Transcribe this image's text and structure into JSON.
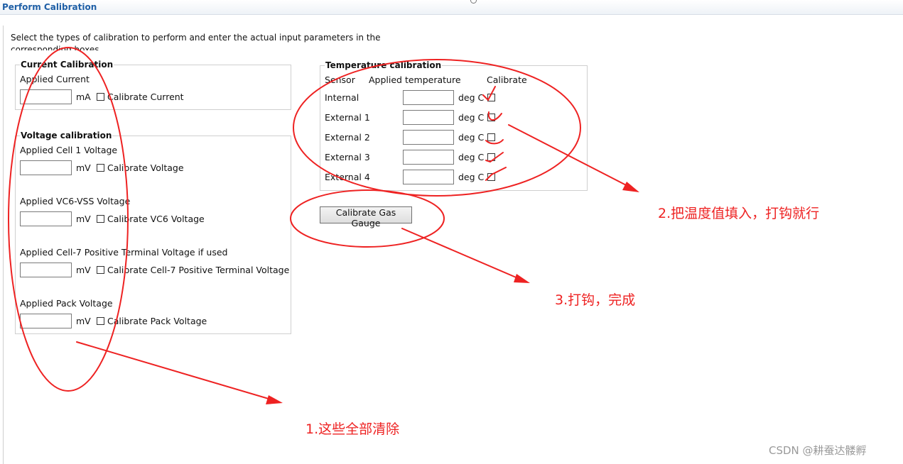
{
  "window": {
    "title": "Perform Calibration"
  },
  "intro": "Select the types of calibration to perform and enter the actual input parameters in the corresponding boxes",
  "current": {
    "legend": "Current Calibration",
    "label": "Applied Current",
    "value": "",
    "unit": "mA",
    "checkbox_label": "Calibrate Current"
  },
  "voltage": {
    "legend": "Voltage calibration",
    "rows": [
      {
        "label": "Applied Cell 1 Voltage",
        "value": "",
        "unit": "mV",
        "checkbox_label": "Calibrate Voltage"
      },
      {
        "label": "Applied VC6-VSS Voltage",
        "value": "",
        "unit": "mV",
        "checkbox_label": "Calibrate VC6 Voltage"
      },
      {
        "label": "Applied Cell-7 Positive Terminal Voltage if used",
        "value": "",
        "unit": "mV",
        "checkbox_label": "Calibrate Cell-7 Positive Terminal Voltage"
      },
      {
        "label": "Applied Pack Voltage",
        "value": "",
        "unit": "mV",
        "checkbox_label": "Calibrate Pack Voltage"
      }
    ]
  },
  "temperature": {
    "legend": "Temperature calibration",
    "headers": {
      "sensor": "Sensor",
      "applied": "Applied temperature",
      "calibrate": "Calibrate"
    },
    "rows": [
      {
        "sensor": "Internal",
        "value": "",
        "unit": "deg C"
      },
      {
        "sensor": "External 1",
        "value": "",
        "unit": "deg C"
      },
      {
        "sensor": "External 2",
        "value": "",
        "unit": "deg C"
      },
      {
        "sensor": "External 3",
        "value": "",
        "unit": "deg C"
      },
      {
        "sensor": "External 4",
        "value": "",
        "unit": "deg C"
      }
    ]
  },
  "action": {
    "button_label": "Calibrate Gas Gauge"
  },
  "annotations": {
    "note1": "1.这些全部清除",
    "note2": "2.把温度值填入，打钩就行",
    "note3": "3.打钩，完成",
    "color": "#ee2222"
  },
  "watermark": "CSDN @耕蚕达髅孵"
}
